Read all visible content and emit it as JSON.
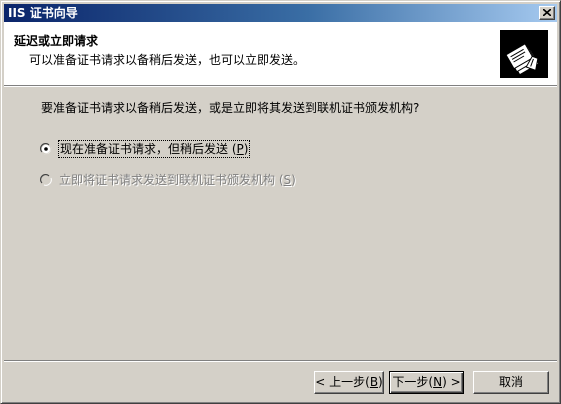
{
  "window": {
    "title": "IIS 证书向导",
    "close_glyph": "×"
  },
  "header": {
    "title": "延迟或立即请求",
    "subtitle": "可以准备证书请求以备稍后发送，也可以立即发送。",
    "icon": "certificate-wizard-icon"
  },
  "body": {
    "question": "要准备证书请求以备稍后发送，或是立即将其发送到联机证书颁发机构?",
    "options": [
      {
        "label": "现在准备证书请求，但稍后发送",
        "accel": "P",
        "selected": true,
        "enabled": true
      },
      {
        "label": "立即将证书请求发送到联机证书颁发机构",
        "accel": "S",
        "selected": false,
        "enabled": false
      }
    ]
  },
  "buttons": {
    "back": {
      "label": "< 上一步",
      "accel": "B"
    },
    "next": {
      "label": "下一步",
      "accel": "N",
      "suffix": " >"
    },
    "cancel": {
      "label": "取消"
    }
  }
}
